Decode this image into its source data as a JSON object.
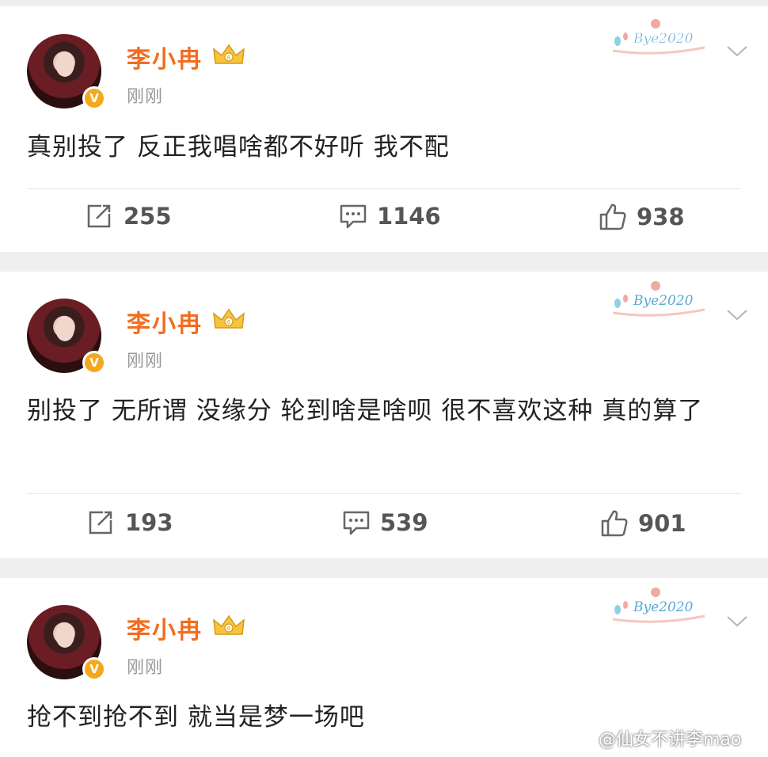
{
  "posts": [
    {
      "username": "李小冉",
      "time": "刚刚",
      "text": "真别投了 反正我唱啥都不好听 我不配",
      "repost_count": "255",
      "comment_count": "1146",
      "like_count": "938",
      "decoration_text": "Bye2020"
    },
    {
      "username": "李小冉",
      "time": "刚刚",
      "text": "别投了 无所谓 没缘分 轮到啥是啥呗 很不喜欢这种 真的算了",
      "repost_count": "193",
      "comment_count": "539",
      "like_count": "901",
      "decoration_text": "Bye2020"
    },
    {
      "username": "李小冉",
      "time": "刚刚",
      "text": "抢不到抢不到 就当是梦一场吧",
      "decoration_text": "Bye2020"
    }
  ],
  "watermark": "@仙女不讲李mao",
  "icons": {
    "verified": "verified-badge-icon",
    "vip": "crown-icon",
    "more": "chevron-down-icon",
    "repost": "repost-icon",
    "comment": "comment-icon",
    "like": "thumb-up-icon"
  },
  "colors": {
    "username": "#f26d1f",
    "background": "#efefef",
    "badge": "#f6a81d"
  }
}
